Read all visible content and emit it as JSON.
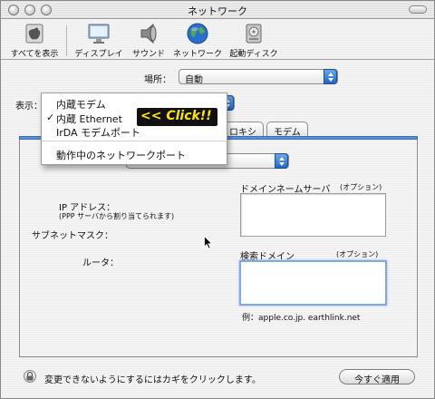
{
  "window": {
    "title": "ネットワーク"
  },
  "toolbar": {
    "items": [
      {
        "label": "すべてを表示",
        "icon": "apple-icon"
      },
      {
        "label": "ディスプレイ",
        "icon": "display-icon"
      },
      {
        "label": "サウンド",
        "icon": "speaker-icon"
      },
      {
        "label": "ネットワーク",
        "icon": "globe-icon"
      },
      {
        "label": "起動ディスク",
        "icon": "disk-icon"
      }
    ]
  },
  "location": {
    "label": "場所：",
    "value": "自動"
  },
  "show": {
    "label": "表示："
  },
  "menu": {
    "items": [
      {
        "label": "内蔵モデム",
        "checked": false
      },
      {
        "label": "内蔵 Ethernet",
        "checked": true
      },
      {
        "label": "IrDA モデムポート",
        "checked": false
      },
      {
        "label": "動作中のネットワークポート",
        "checked": false
      }
    ],
    "checkmark": "✓"
  },
  "annotation": {
    "label": "<< Click!!"
  },
  "tabs": [
    {
      "label": "ロキシ"
    },
    {
      "label": "モデム"
    }
  ],
  "form": {
    "ip_label": "IP アドレス：",
    "ip_note": "(PPP サーバから割り当てられます)",
    "subnet_label": "サブネットマスク：",
    "router_label": "ルータ：",
    "dns_label": "ドメインネームサーバ",
    "dns_optional": "(オプション)",
    "search_label": "検索ドメイン",
    "search_optional": "(オプション)",
    "example": "例：apple.co.jp.  earthlink.net"
  },
  "footer": {
    "lock_text": "変更できないようにするにはカギをクリックします。",
    "apply_label": "今すぐ適用"
  },
  "colors": {
    "accent": "#1f67c8",
    "click_bg": "#111111",
    "click_fg": "#ffe600"
  }
}
